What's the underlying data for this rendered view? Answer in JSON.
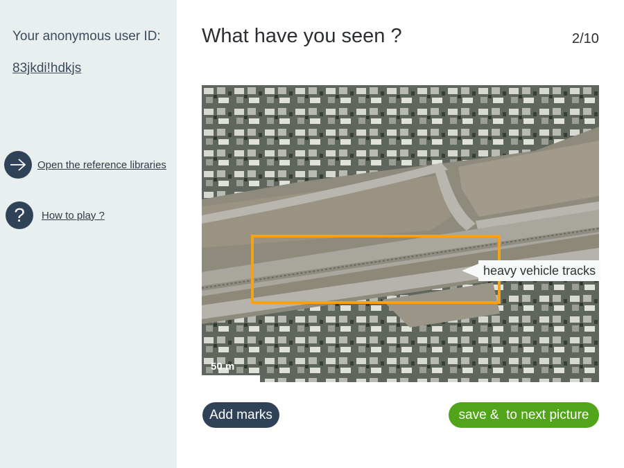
{
  "sidebar": {
    "user_id_label": "Your anonymous user ID:",
    "user_id": "83jkdi!hdkjs",
    "items": [
      {
        "label": "Open the reference libraries",
        "icon": "arrow-right-icon"
      },
      {
        "label": "How to play ?",
        "icon": "question-icon"
      }
    ]
  },
  "main": {
    "title": "What have you seen ?",
    "progress": "2/10",
    "image": {
      "scale_label": "50 m",
      "annotation": {
        "label": "heavy vehicle tracks",
        "box_color": "#f5a21b"
      }
    },
    "add_marks_label": "Add marks",
    "save_label": "save &  to next picture"
  },
  "colors": {
    "sidebar_bg": "#e9eeef",
    "primary_dark": "#2f4258",
    "save_green": "#52a41a",
    "mark_orange": "#f5a21b"
  }
}
